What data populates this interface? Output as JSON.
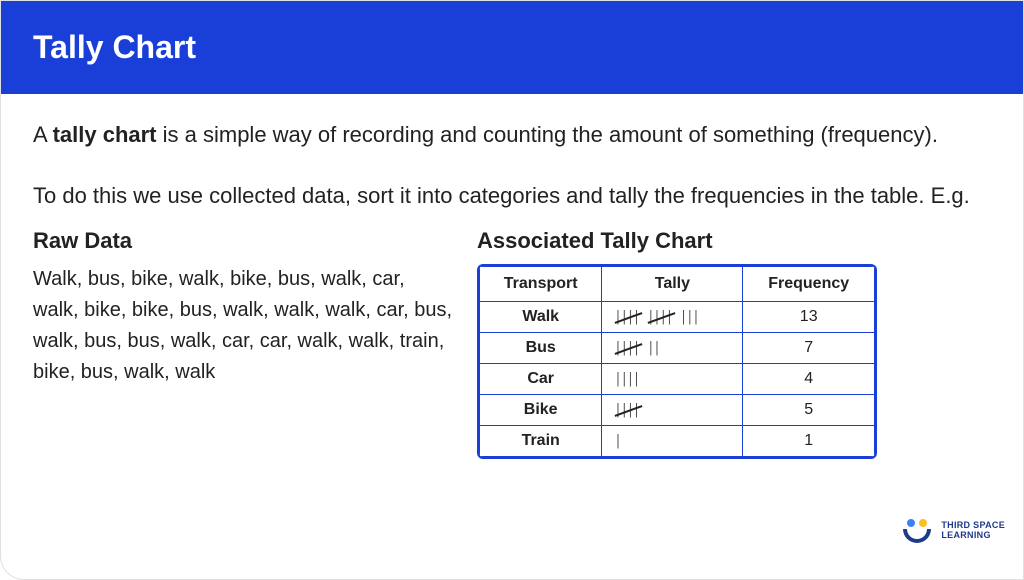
{
  "header": {
    "title": "Tally Chart"
  },
  "intro": {
    "prefix": "A ",
    "bold": "tally chart",
    "suffix": " is a simple way of recording and counting the amount of something (frequency)."
  },
  "second_para": "To do this we use collected data, sort it into categories and tally the frequencies in the table. E.g.",
  "raw_data": {
    "heading": "Raw Data",
    "text": "Walk, bus, bike, walk, bike, bus, walk, car, walk, bike, bike, bus, walk, walk, walk,  car, bus, walk, bus, bus, walk, car, car, walk, walk, train, bike, bus, walk, walk"
  },
  "chart": {
    "heading": "Associated Tally Chart",
    "columns": {
      "c1": "Transport",
      "c2": "Tally",
      "c3": "Frequency"
    }
  },
  "chart_data": {
    "type": "table",
    "title": "Associated Tally Chart",
    "columns": [
      "Transport",
      "Tally",
      "Frequency"
    ],
    "rows": [
      {
        "transport": "Walk",
        "tally_value": 13,
        "frequency": "13"
      },
      {
        "transport": "Bus",
        "tally_value": 7,
        "frequency": "7"
      },
      {
        "transport": "Car",
        "tally_value": 4,
        "frequency": "4"
      },
      {
        "transport": "Bike",
        "tally_value": 5,
        "frequency": "5"
      },
      {
        "transport": "Train",
        "tally_value": 1,
        "frequency": "1"
      }
    ]
  },
  "brand": {
    "line1": "THIRD SPACE",
    "line2": "LEARNING"
  }
}
